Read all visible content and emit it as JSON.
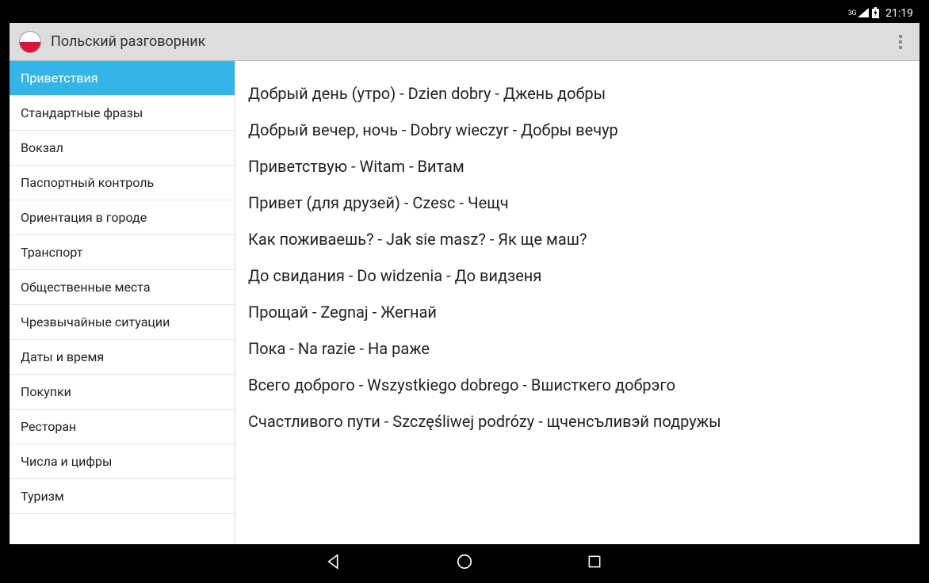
{
  "status_bar": {
    "network_label": "3G",
    "time": "21:19"
  },
  "app_bar": {
    "title": "Польский разговорник"
  },
  "sidebar": {
    "items": [
      {
        "label": "Приветствия",
        "selected": true
      },
      {
        "label": "Стандартные фразы",
        "selected": false
      },
      {
        "label": "Вокзал",
        "selected": false
      },
      {
        "label": "Паспортный контроль",
        "selected": false
      },
      {
        "label": "Ориентация в городе",
        "selected": false
      },
      {
        "label": "Транспорт",
        "selected": false
      },
      {
        "label": "Общественные места",
        "selected": false
      },
      {
        "label": "Чрезвычайные ситуации",
        "selected": false
      },
      {
        "label": "Даты и время",
        "selected": false
      },
      {
        "label": "Покупки",
        "selected": false
      },
      {
        "label": "Ресторан",
        "selected": false
      },
      {
        "label": "Числа и цифры",
        "selected": false
      },
      {
        "label": "Туризм",
        "selected": false
      }
    ]
  },
  "phrases": [
    "Добрый день (утро) - Dzien dobry - Джень добры",
    "Добрый вечер, ночь - Dobry wieczyr - Добры вечур",
    "Приветствую - Witam - Витам",
    "Привет (для друзей) - Czesc - Чещч",
    "Как поживаешь? - Jak sie masz? - Як ще маш?",
    "До свидания - Do widzenia - До видзеня",
    "Прощай - Zegnaj - Жегнай",
    "Пока - Na razie - На раже",
    "Всего доброго - Wszystkiego dobrego - Вшисткего добрэго",
    "Счастливого пути - Szczęśliwej podrózy - щченсъливэй подружы"
  ]
}
